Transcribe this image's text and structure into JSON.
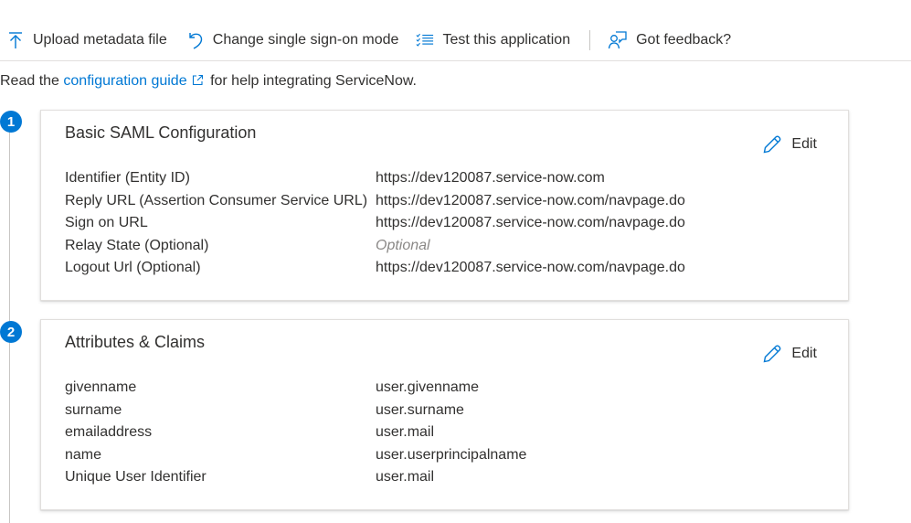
{
  "toolbar": {
    "upload_label": "Upload metadata file",
    "change_mode_label": "Change single sign-on mode",
    "test_label": "Test this application",
    "feedback_label": "Got feedback?",
    "icons": [
      "upload-icon",
      "undo-icon",
      "checklist-icon",
      "feedback-icon"
    ]
  },
  "intro": {
    "prefix": "Read the",
    "link_text": "configuration guide",
    "suffix": "for help integrating ServiceNow."
  },
  "sections": [
    {
      "step": "1",
      "title": "Basic SAML Configuration",
      "edit_label": "Edit",
      "rows": [
        {
          "key": "Identifier (Entity ID)",
          "value": "https://dev120087.service-now.com"
        },
        {
          "key": "Reply URL (Assertion Consumer Service URL)",
          "value": "https://dev120087.service-now.com/navpage.do"
        },
        {
          "key": "Sign on URL",
          "value": "https://dev120087.service-now.com/navpage.do"
        },
        {
          "key": "Relay State (Optional)",
          "value": "Optional"
        },
        {
          "key": "Logout Url (Optional)",
          "value": "https://dev120087.service-now.com/navpage.do"
        }
      ]
    },
    {
      "step": "2",
      "title": "Attributes & Claims",
      "edit_label": "Edit",
      "rows": [
        {
          "key": "givenname",
          "value": "user.givenname"
        },
        {
          "key": "surname",
          "value": "user.surname"
        },
        {
          "key": "emailaddress",
          "value": "user.mail"
        },
        {
          "key": "name",
          "value": "user.userprincipalname"
        },
        {
          "key": "Unique User Identifier",
          "value": "user.mail"
        }
      ]
    }
  ],
  "colors": {
    "accent": "#0078d4",
    "text": "#323130",
    "placeholder": "#8a8886"
  }
}
